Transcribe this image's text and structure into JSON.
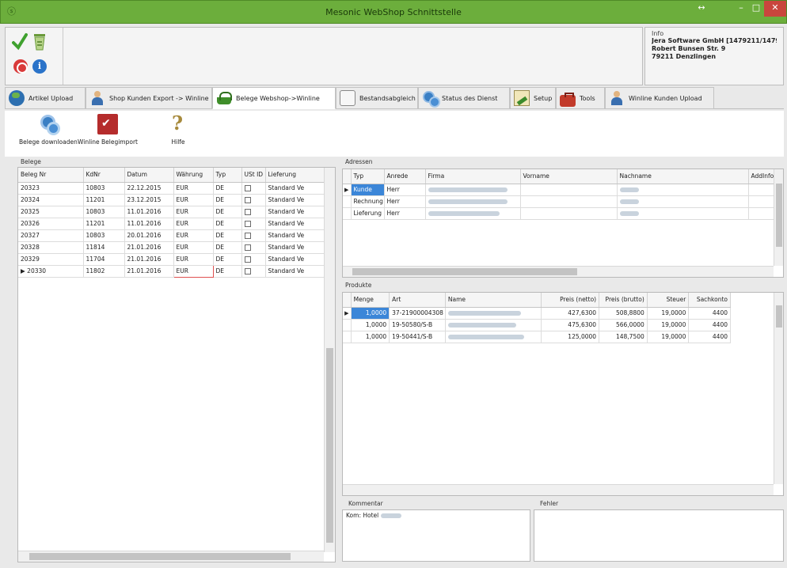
{
  "window": {
    "title": "Mesonic WebShop Schnittstelle",
    "app_icon": "ⓢ",
    "restore_glyph": "↔",
    "minimize_glyph": "–",
    "maximize_glyph": "□",
    "close_glyph": "✕"
  },
  "info": {
    "title": "Info",
    "lines": [
      "Jera Software GmbH [1479211/1479",
      "Robert Bunsen Str. 9",
      "79211 Denzlingen"
    ]
  },
  "tabs": [
    {
      "label": "Artikel Upload",
      "icon": "globe-icon"
    },
    {
      "label": "Shop Kunden Export -> Winline",
      "icon": "user-icon"
    },
    {
      "label": "Belege Webshop->Winline",
      "icon": "basket-icon",
      "active": true
    },
    {
      "label": "Bestandsabgleich",
      "icon": "people-icon"
    },
    {
      "label": "Status des Dienst",
      "icon": "gears-icon"
    },
    {
      "label": "Setup",
      "icon": "setup-icon"
    },
    {
      "label": "Tools",
      "icon": "toolbox-icon"
    },
    {
      "label": "Winline Kunden Upload",
      "icon": "user-icon"
    }
  ],
  "toolbar": {
    "download_label": "Belege downloaden",
    "import_label": "Winline Belegimport",
    "help_label": "Hilfe"
  },
  "belege": {
    "group_label": "Belege",
    "columns": [
      "Beleg Nr",
      "KdNr",
      "Datum",
      "Währung",
      "Typ",
      "USt ID",
      "Lieferung"
    ],
    "rows": [
      [
        "20323",
        "10803",
        "22.12.2015",
        "EUR",
        "DE",
        "",
        "Standard Ve"
      ],
      [
        "20324",
        "11201",
        "23.12.2015",
        "EUR",
        "DE",
        "",
        "Standard Ve"
      ],
      [
        "20325",
        "10803",
        "11.01.2016",
        "EUR",
        "DE",
        "",
        "Standard Ve"
      ],
      [
        "20326",
        "11201",
        "11.01.2016",
        "EUR",
        "DE",
        "",
        "Standard Ve"
      ],
      [
        "20327",
        "10803",
        "20.01.2016",
        "EUR",
        "DE",
        "",
        "Standard Ve"
      ],
      [
        "20328",
        "11814",
        "21.01.2016",
        "EUR",
        "DE",
        "",
        "Standard Ve"
      ],
      [
        "20329",
        "11704",
        "21.01.2016",
        "EUR",
        "DE",
        "",
        "Standard Ve"
      ],
      [
        "20330",
        "11802",
        "21.01.2016",
        "EUR",
        "DE",
        "",
        "Standard Ve"
      ]
    ],
    "current_row_marker": "▶"
  },
  "adressen": {
    "group_label": "Adressen",
    "columns": [
      "Typ",
      "Anrede",
      "Firma",
      "Vorname",
      "Nachname",
      "AddInfo"
    ],
    "rows": [
      [
        "Kunde",
        "Herr"
      ],
      [
        "Rechnung",
        "Herr"
      ],
      [
        "Lieferung",
        "Herr"
      ]
    ]
  },
  "produkte": {
    "group_label": "Produkte",
    "columns": [
      "Menge",
      "Art",
      "Name",
      "Preis (netto)",
      "Preis (brutto)",
      "Steuer",
      "Sachkonto"
    ],
    "rows": [
      [
        "1,0000",
        "37-21900004308",
        "427,6300",
        "508,8800",
        "19,0000",
        "4400"
      ],
      [
        "1,0000",
        "19-50580/S-B",
        "475,6300",
        "566,0000",
        "19,0000",
        "4400"
      ],
      [
        "1,0000",
        "19-50441/S-B",
        "125,0000",
        "148,7500",
        "19,0000",
        "4400"
      ]
    ]
  },
  "kommentar": {
    "label": "Kommentar",
    "value": "Kom: Hotel"
  },
  "fehler": {
    "label": "Fehler",
    "value": ""
  },
  "colors": {
    "titlebar": "#6cae3c",
    "selection": "#3b86d8",
    "close": "#c9463d"
  }
}
